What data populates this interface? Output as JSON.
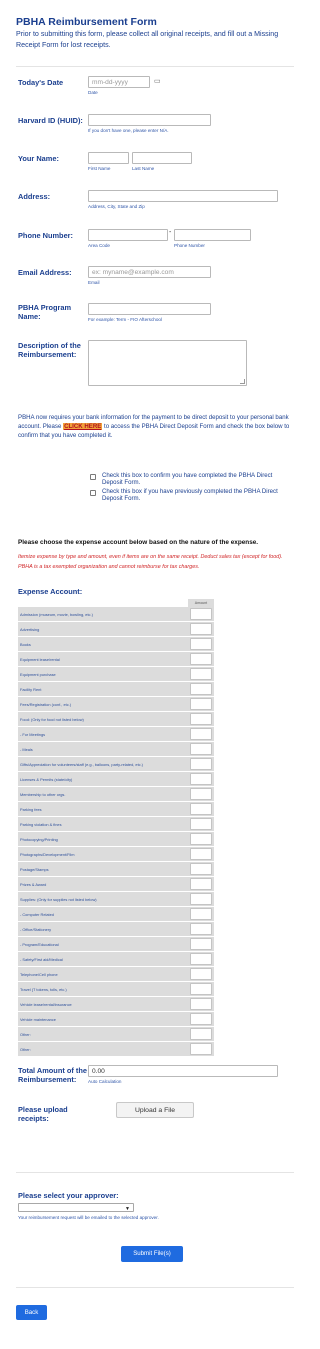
{
  "form": {
    "title": "PBHA Reimbursement Form",
    "intro": "Prior to submitting this form, please collect all original receipts, and fill out a Missing Receipt Form for lost receipts."
  },
  "date": {
    "label": "Today's Date",
    "placeholder": "mm-dd-yyyy",
    "sub": "Date"
  },
  "huid": {
    "label": "Harvard ID (HUID):",
    "sub": "If you don't have one, please enter N/A."
  },
  "name": {
    "label": "Your Name:",
    "first_sub": "First Name",
    "last_sub": "Last Name"
  },
  "address": {
    "label": "Address:",
    "sub": "Address, City, State and Zip"
  },
  "phone": {
    "label": "Phone Number:",
    "dash": "-",
    "area_sub": "Area Code",
    "number_sub": "Phone Number"
  },
  "email": {
    "label": "Email Address:",
    "placeholder": "ex: myname@example.com",
    "sub": "Email"
  },
  "program": {
    "label_line1": "PBHA Program",
    "label_line2": "Name:",
    "sub": "For example: Term - FIO Afterschool"
  },
  "description": {
    "label_line1": "Description of the",
    "label_line2": "Reimbursement:"
  },
  "bank": {
    "text_before": "PBHA now requires your bank information for the payment to be direct deposit to your personal bank account.  Please ",
    "link": "CLICK HERE",
    "text_after": " to access the PBHA Direct Deposit Form and check the box below to confirm that you have completed it.",
    "checkbox1": "Check this box to confirm you have completed the PBHA Direct Deposit Form.",
    "checkbox2": "Check this box if you have previously completed the PBHA Direct Deposit Form."
  },
  "expense_intro": {
    "heading": "Please choose the expense account below based on the nature of the expense.",
    "note": "Itemize expense by type and amount, even if items are on the same receipt.  Deduct sales tax (except for food).  PBHA is a tax exempted organization and cannot reimburse for tax charges."
  },
  "expense": {
    "label": "Expense Account:",
    "amount_header": "Amount",
    "rows": [
      "Admission (museum, movie, bowling, etc.)",
      "Advertising",
      "Books",
      "Equipment lease/rental",
      "Equipment purchase",
      "Facility Rent",
      "Fees/Registration (conf., etc.)",
      "Food: (Only for food not listed below)",
      "- For Meetings",
      "- Meals",
      "Gifts/Appreciation for volunteers/staff (e.g., balloons, party-related, etc.)",
      "Licenses & Permits (state/city)",
      "Membership to other orgs.",
      "Parking fees",
      "Parking violation & fines",
      "Photocopying/Printing",
      "Photographs/Development/Film",
      "Postage/Stamps",
      "Prizes & Award",
      "Supplies: (Only for supplies not listed below)",
      "- Computer Related",
      "- Office/Stationery",
      "- Program/Educational",
      "- Safety/First aid/Medical",
      "Telephone/Cell phone",
      "Travel (T tokens, tolls, etc.)",
      "Vehicle lease/rental/insurance",
      "Vehicle maintenance",
      "Other:",
      "Other:"
    ]
  },
  "total": {
    "label_line1": "Total Amount of the",
    "label_line2": "Reimbursement:",
    "value": "0.00",
    "sub": "Auto Calculation"
  },
  "upload": {
    "label_line1": "Please upload",
    "label_line2": "receipts:",
    "button": "Upload a File"
  },
  "approver": {
    "label": "Please select your approver:",
    "selected": "",
    "sub": "Your reimbursement request will be emailed to the selected approver."
  },
  "buttons": {
    "submit": "Submit File(s)",
    "back": "Back"
  }
}
